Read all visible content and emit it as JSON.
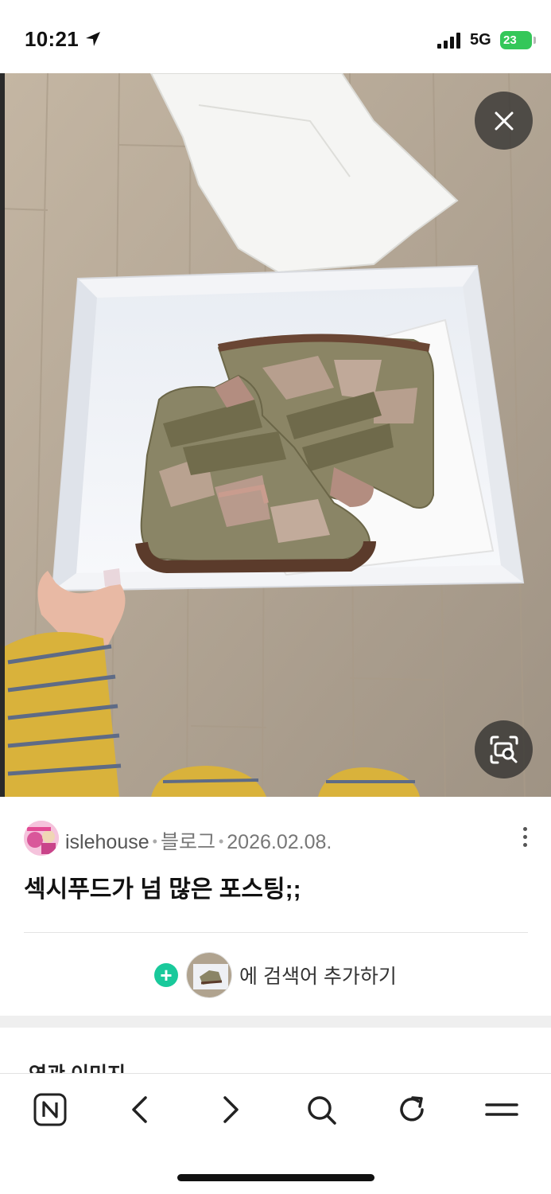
{
  "status_bar": {
    "time": "10:21",
    "network": "5G",
    "battery": "23",
    "icons": [
      "location-arrow-icon",
      "signal-bars-icon",
      "battery-charging-icon"
    ]
  },
  "viewer": {
    "close_icon": "close-icon",
    "lens_icon": "image-search-icon"
  },
  "result": {
    "source_name": "islehouse",
    "source_type": "블로그",
    "date": "2026.02.08.",
    "title": "섹시푸드가 넘 많은 포스팅;;",
    "more_icon": "more-vertical-icon"
  },
  "add_search": {
    "label": "에 검색어 추가하기",
    "icon": "plus-circle-icon"
  },
  "related": {
    "title": "연관 이미지"
  },
  "toolbar": {
    "buttons": [
      "naver-home-icon",
      "back-icon",
      "forward-icon",
      "search-icon",
      "refresh-icon",
      "menu-icon"
    ]
  },
  "colors": {
    "accent_green": "#19c99b",
    "battery_green": "#34c759",
    "floor": "#b8aa98",
    "sneaker_suede": "#8a8566",
    "sneaker_pink": "#b89a8c",
    "sole_brown": "#5b3b2b"
  }
}
